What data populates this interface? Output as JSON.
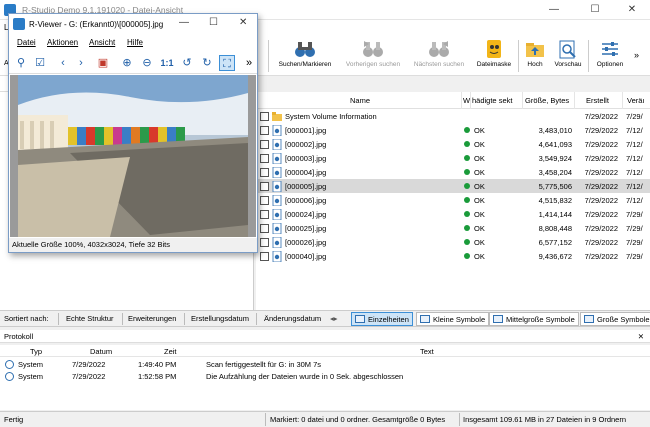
{
  "window": {
    "title": "R-Studio Demo 9.1.191020 - Datei-Ansicht",
    "minimize": "—",
    "maximize": "☐",
    "close": "✕"
  },
  "menubar": {
    "partial_left": "La"
  },
  "toolbar": {
    "buttons": [
      {
        "label": "Suchen/Markieren",
        "icon": "binoculars-icon",
        "enabled": true
      },
      {
        "label": "Vorherigen suchen",
        "icon": "binoculars-prev-icon",
        "enabled": false
      },
      {
        "label": "Nächsten suchen",
        "icon": "binoculars-next-icon",
        "enabled": false
      },
      {
        "label": "Dateimaske",
        "icon": "file-mask-icon",
        "enabled": true
      },
      {
        "label": "Hoch",
        "icon": "folder-up-icon",
        "enabled": true
      },
      {
        "label": "Vorschau",
        "icon": "preview-icon",
        "enabled": true
      },
      {
        "label": "Optionen",
        "icon": "options-icon",
        "enabled": true
      }
    ],
    "overflow": "»",
    "partial_left": "Al"
  },
  "list": {
    "headers": {
      "name": "Name",
      "w": "W",
      "damaged": "hädigte sekt",
      "size": "Größe, Bytes",
      "created": "Erstellt",
      "changed": "Veräı"
    },
    "rows": [
      {
        "name": "System Volume Information",
        "type": "folder",
        "status": "",
        "size": "",
        "created": "7/29/2022",
        "changed": "7/29/",
        "selected": false
      },
      {
        "name": "[000001].jpg",
        "type": "image",
        "status": "OK",
        "size": "3,483,010",
        "created": "7/29/2022",
        "changed": "7/12/",
        "selected": false
      },
      {
        "name": "[000002].jpg",
        "type": "image",
        "status": "OK",
        "size": "4,641,093",
        "created": "7/29/2022",
        "changed": "7/12/",
        "selected": false
      },
      {
        "name": "[000003].jpg",
        "type": "image",
        "status": "OK",
        "size": "3,549,924",
        "created": "7/29/2022",
        "changed": "7/12/",
        "selected": false
      },
      {
        "name": "[000004].jpg",
        "type": "image",
        "status": "OK",
        "size": "3,458,204",
        "created": "7/29/2022",
        "changed": "7/12/",
        "selected": false
      },
      {
        "name": "[000005].jpg",
        "type": "image",
        "status": "OK",
        "size": "5,775,506",
        "created": "7/29/2022",
        "changed": "7/12/",
        "selected": true
      },
      {
        "name": "[000006].jpg",
        "type": "image",
        "status": "OK",
        "size": "4,515,832",
        "created": "7/29/2022",
        "changed": "7/12/",
        "selected": false
      },
      {
        "name": "[000024].jpg",
        "type": "image",
        "status": "OK",
        "size": "1,414,144",
        "created": "7/29/2022",
        "changed": "7/29/",
        "selected": false
      },
      {
        "name": "[000025].jpg",
        "type": "image",
        "status": "OK",
        "size": "8,808,448",
        "created": "7/29/2022",
        "changed": "7/29/",
        "selected": false
      },
      {
        "name": "[000026].jpg",
        "type": "image",
        "status": "OK",
        "size": "6,577,152",
        "created": "7/29/2022",
        "changed": "7/29/",
        "selected": false
      },
      {
        "name": "[000040].jpg",
        "type": "image",
        "status": "OK",
        "size": "9,436,672",
        "created": "7/29/2022",
        "changed": "7/29/",
        "selected": false
      }
    ]
  },
  "viewtabs": {
    "sorted_by": "Sortiert nach:",
    "tabs": [
      "Echte Struktur",
      "Erweiterungen",
      "Erstellungsdatum",
      "Änderungsdatum"
    ],
    "views": [
      {
        "label": "Einzelheiten",
        "active": true
      },
      {
        "label": "Kleine Symbole",
        "active": false
      },
      {
        "label": "Mittelgroße Symbole",
        "active": false
      },
      {
        "label": "Große Symbole",
        "active": false
      }
    ]
  },
  "protokoll": {
    "title": "Protokoll",
    "close": "✕",
    "headers": {
      "typ": "Typ",
      "datum": "Datum",
      "zeit": "Zeit",
      "text": "Text"
    },
    "rows": [
      {
        "typ": "System",
        "datum": "7/29/2022",
        "zeit": "1:49:40 PM",
        "text": "Scan fertiggestellt für G: in 30M 7s"
      },
      {
        "typ": "System",
        "datum": "7/29/2022",
        "zeit": "1:52:58 PM",
        "text": "Die Aufzählung der Dateien wurde in 0 Sek. abgeschlossen"
      }
    ]
  },
  "statusbar": {
    "left": "Fertig",
    "middle": "Markiert: 0 datei und 0 ordner. Gesamtgröße 0 Bytes",
    "right": "Insgesamt 109.61 MB in 27 Dateien in 9 Ordnern"
  },
  "viewer": {
    "title": "R-Viewer - G: (Erkannt0)\\[000005].jpg",
    "minimize": "—",
    "maximize": "☐",
    "close": "✕",
    "menu": [
      "Datei",
      "Aktionen",
      "Ansicht",
      "Hilfe"
    ],
    "overflow": "»",
    "status": "Aktuelle Größe 100%, 4032x3024, Tiefe 32 Bits",
    "one_to_one": "1:1"
  },
  "colors": {
    "accent": "#2a7cc7",
    "ok_dot": "#1a9b3a",
    "selected_row": "#d9d9d9",
    "active_tab": "#cde4f7"
  }
}
